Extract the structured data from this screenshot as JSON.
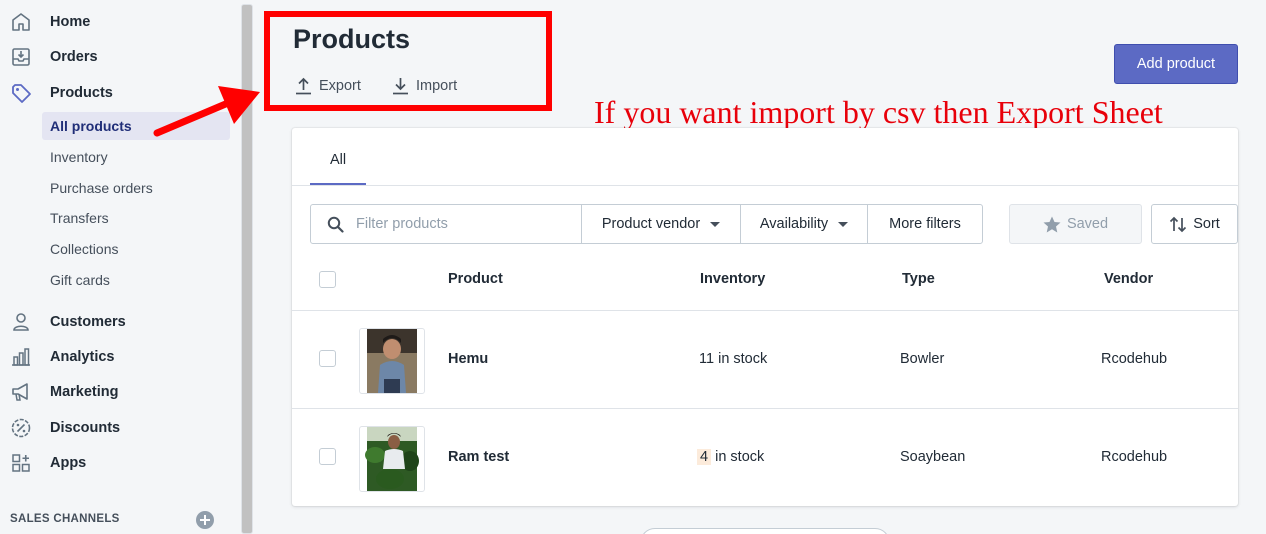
{
  "sidebar": {
    "nav": [
      {
        "label": "Home",
        "icon": "home-icon"
      },
      {
        "label": "Orders",
        "icon": "orders-icon"
      },
      {
        "label": "Products",
        "icon": "tag-icon"
      }
    ],
    "product_subnav": [
      "All products",
      "Inventory",
      "Purchase orders",
      "Transfers",
      "Collections",
      "Gift cards"
    ],
    "nav2": [
      {
        "label": "Customers",
        "icon": "person-icon"
      },
      {
        "label": "Analytics",
        "icon": "bar-chart-icon"
      },
      {
        "label": "Marketing",
        "icon": "megaphone-icon"
      },
      {
        "label": "Discounts",
        "icon": "discount-icon"
      },
      {
        "label": "Apps",
        "icon": "apps-icon"
      }
    ],
    "sales_channels_label": "SALES CHANNELS"
  },
  "header": {
    "title": "Products",
    "export_label": "Export",
    "import_label": "Import",
    "add_product_label": "Add product"
  },
  "annotation": {
    "text": "If you want import by csv then Export Sheet",
    "color": "#e8000a"
  },
  "tabs": [
    {
      "label": "All"
    }
  ],
  "filters": {
    "search_placeholder": "Filter products",
    "product_vendor": "Product vendor",
    "availability": "Availability",
    "more_filters": "More filters",
    "saved": "Saved",
    "sort": "Sort"
  },
  "table": {
    "columns": [
      "Product",
      "Inventory",
      "Type",
      "Vendor"
    ],
    "rows": [
      {
        "product": "Hemu",
        "inventory_qty": "11",
        "inventory_suffix": " in stock",
        "type": "Bowler",
        "vendor": "Rcodehub"
      },
      {
        "product": "Ram test",
        "inventory_qty": "4",
        "inventory_suffix": " in stock",
        "type": "Soaybean",
        "vendor": "Rcodehub"
      }
    ]
  },
  "colors": {
    "accent": "#5c6ac4",
    "highlight_border": "#ff0000",
    "low_stock_bg": "#fcebdb"
  }
}
